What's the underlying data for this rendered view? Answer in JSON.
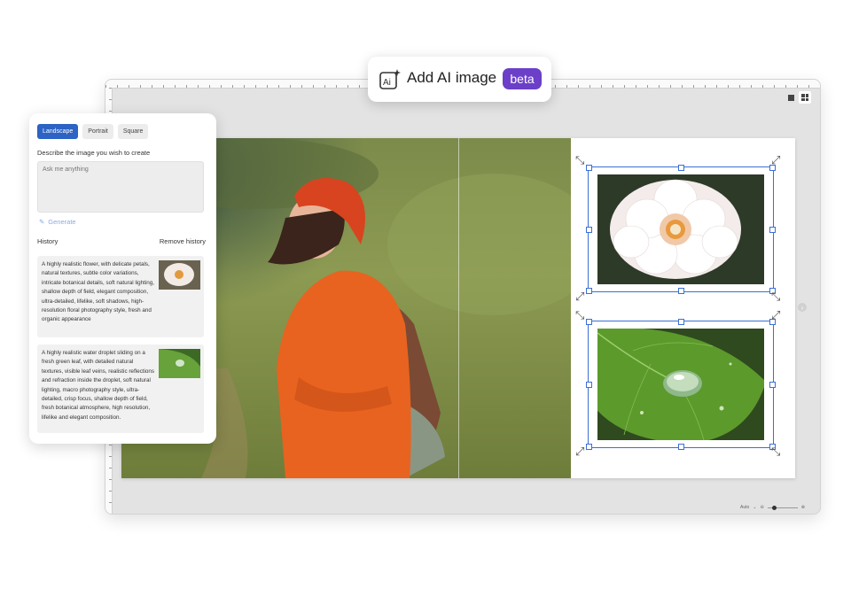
{
  "ai_badge": {
    "title": "Add AI image",
    "beta": "beta",
    "icon": "ai-image-icon"
  },
  "panel": {
    "tabs": [
      {
        "label": "Landscape",
        "active": true
      },
      {
        "label": "Portrait",
        "active": false
      },
      {
        "label": "Square",
        "active": false
      }
    ],
    "describe_label": "Describe the image you wish to create",
    "prompt_placeholder": "Ask me anything",
    "generate_label": "Generate",
    "history_label": "History",
    "remove_history_label": "Remove history",
    "history": [
      {
        "text": "A highly realistic flower, with delicate petals, natural textures, subtle color variations, intricate botanical details, soft natural lighting, shallow depth of field, elegant composition, ultra-detailed, lifelike, soft shadows, high-resolution floral photography style, fresh and organic appearance",
        "thumb": "flower-thumbnail"
      },
      {
        "text": "A highly realistic water droplet sliding on a fresh green leaf, with detailed natural textures, visible leaf veins, realistic reflections and refraction inside the droplet, soft natural lighting, macro photography style, ultra-detailed, crisp focus, shallow depth of field, fresh botanical atmosphere, high resolution, lifelike and elegant composition.",
        "thumb": "leaf-thumbnail"
      }
    ]
  },
  "editor": {
    "view_modes": [
      "single-page-icon",
      "grid-view-icon"
    ],
    "zoom_label": "Auto",
    "accent": "#3b6fd4"
  },
  "colors": {
    "primary": "#2c63c4",
    "beta": "#6b3fc8",
    "selection": "#3b6fd4"
  }
}
